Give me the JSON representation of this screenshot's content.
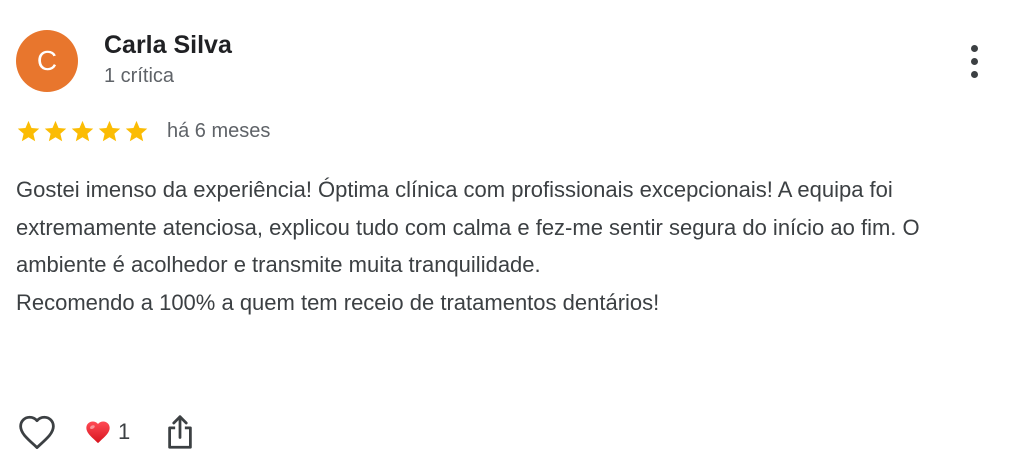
{
  "reviewer": {
    "avatar_initial": "C",
    "avatar_color": "#e8762d",
    "name": "Carla Silva",
    "meta": "1 crítica"
  },
  "review": {
    "rating": 5,
    "rating_max": 5,
    "star_color": "#fbbc04",
    "date": "há 6 meses",
    "paragraphs": [
      "Gostei imenso da experiência! Óptima clínica com profissionais excepcionais! A equipa foi extremamente atenciosa, explicou tudo com calma e fez-me sentir segura do início ao fim. O ambiente é acolhedor e transmite muita tranquilidade.",
      "Recomendo a 100% a quem tem receio de tratamentos dentários!"
    ]
  },
  "actions": {
    "like_icon": "heart-outline-icon",
    "reaction_icon": "red-heart-icon",
    "reaction_count": "1",
    "share_icon": "share-icon",
    "more_icon": "more-vertical-icon"
  }
}
